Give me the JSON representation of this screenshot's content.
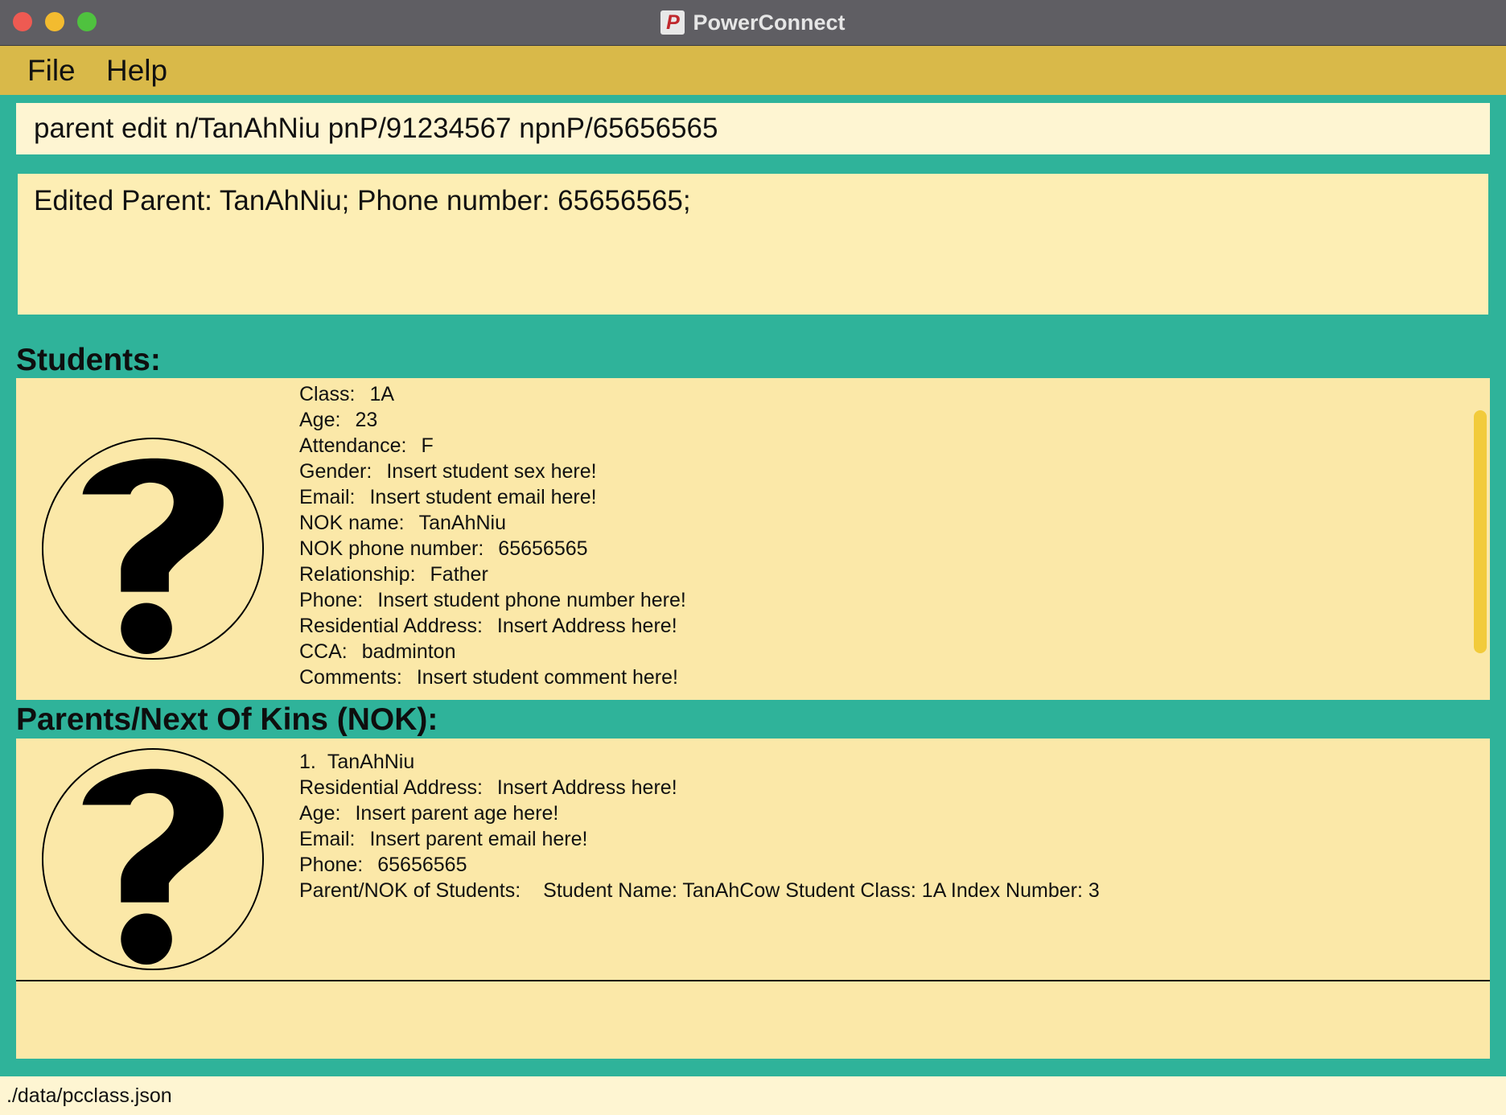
{
  "window": {
    "title": "PowerConnect",
    "app_icon_glyph": "P"
  },
  "menu": {
    "file": "File",
    "help": "Help"
  },
  "command": {
    "value": "parent edit n/TanAhNiu pnP/91234567 npnP/65656565"
  },
  "result": {
    "text": "Edited Parent: TanAhNiu; Phone number: 65656565;"
  },
  "sections": {
    "students": "Students:",
    "parents": "Parents/Next Of Kins (NOK):"
  },
  "student": {
    "rows": [
      {
        "label": "Class:",
        "value": "1A"
      },
      {
        "label": "Age:",
        "value": "23"
      },
      {
        "label": "Attendance:",
        "value": "F"
      },
      {
        "label": "Gender:",
        "value": "Insert student sex here!"
      },
      {
        "label": "Email:",
        "value": "Insert student email here!"
      },
      {
        "label": "NOK name:",
        "value": "TanAhNiu"
      },
      {
        "label": "NOK phone number:",
        "value": "65656565"
      },
      {
        "label": "Relationship:",
        "value": "Father"
      },
      {
        "label": "Phone:",
        "value": "Insert student phone number here!"
      },
      {
        "label": "Residential Address:",
        "value": "Insert Address here!"
      },
      {
        "label": "CCA:",
        "value": "badminton"
      },
      {
        "label": "Comments:",
        "value": "Insert student comment here!"
      }
    ]
  },
  "parent": {
    "title_row": {
      "index": "1.",
      "name": "TanAhNiu"
    },
    "rows": [
      {
        "label": "Residential Address:",
        "value": "Insert Address here!"
      },
      {
        "label": "Age:",
        "value": "Insert parent age here!"
      },
      {
        "label": "Email:",
        "value": "Insert parent email here!"
      },
      {
        "label": "Phone:",
        "value": "65656565"
      },
      {
        "label": "Parent/NOK of Students:",
        "value": "Student Name: TanAhCow Student Class: 1A Index Number: 3"
      }
    ]
  },
  "status": {
    "path": "./data/pcclass.json"
  },
  "colors": {
    "background": "#2fb39a",
    "menubar": "#d9b949",
    "card": "#fbe8a8",
    "input": "#fef5d2",
    "scrollbar": "#f2cb3b"
  }
}
